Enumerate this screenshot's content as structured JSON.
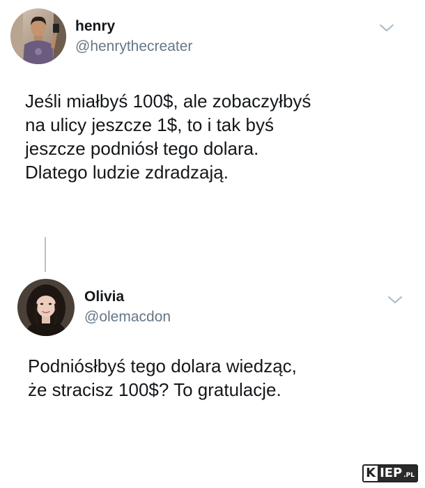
{
  "tweets": [
    {
      "author": {
        "name": "henry",
        "handle": "@henrythecreater",
        "avatar": "avatar-photo-man"
      },
      "menu_icon": "chevron-down-icon",
      "text_lines": [
        "Jeśli miałbyś 100$, ale zobaczyłbyś",
        "na ulicy jeszcze 1$, to i tak byś",
        "jeszcze podniósł tego dolara.",
        "Dlatego ludzie zdradzają."
      ]
    },
    {
      "author": {
        "name": "Olivia",
        "handle": "@olemacdon",
        "avatar": "avatar-photo-woman"
      },
      "menu_icon": "chevron-down-icon",
      "text_lines": [
        "Podniósłbyś tego dolara wiedząc,",
        "że stracisz 100$? To gratulacje."
      ]
    }
  ],
  "watermark": {
    "part1": "K",
    "part2": "IEP",
    "part3": ".PL"
  },
  "colors": {
    "text": "#14171a",
    "secondary": "#657786",
    "thread_line": "#b8c1c9",
    "chevron": "#aab8c2"
  }
}
